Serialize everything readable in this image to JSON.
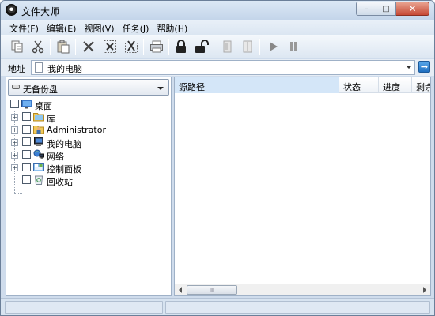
{
  "window": {
    "title": "文件大师",
    "buttons": {
      "minimize": "–",
      "maximize": "□",
      "close": "✕"
    }
  },
  "menubar": {
    "items": [
      {
        "label": "文件(F)"
      },
      {
        "label": "编辑(E)"
      },
      {
        "label": "视图(V)"
      },
      {
        "label": "任务(J)"
      },
      {
        "label": "帮助(H)"
      }
    ]
  },
  "toolbar": {
    "icons": [
      "copy-icon",
      "cut-icon",
      "paste-icon",
      "delete-icon",
      "select-delete-icon",
      "select-all-delete-icon",
      "print-icon",
      "lock-icon",
      "unlock-icon",
      "tag-icon",
      "file-icon",
      "play-icon",
      "pause-icon"
    ]
  },
  "address": {
    "label": "地址",
    "value": "我的电脑",
    "go": "→"
  },
  "drive": {
    "selected": "无备份盘"
  },
  "tree": {
    "items": [
      {
        "label": "桌面",
        "icon": "desktop-icon"
      },
      {
        "label": "库",
        "icon": "library-icon"
      },
      {
        "label": "Administrator",
        "icon": "user-folder-icon"
      },
      {
        "label": "我的电脑",
        "icon": "computer-icon"
      },
      {
        "label": "网络",
        "icon": "network-icon"
      },
      {
        "label": "控制面板",
        "icon": "control-panel-icon"
      },
      {
        "label": "回收站",
        "icon": "recycle-bin-icon"
      }
    ],
    "expander": "+"
  },
  "table": {
    "columns": [
      "源路径",
      "状态",
      "进度",
      "剩余"
    ]
  },
  "scrollbar": {
    "grip": "III"
  },
  "colors": {
    "window_bg": "#cfdcec",
    "selected_header": "#d4e6f8",
    "close_button": "#c74a36"
  }
}
